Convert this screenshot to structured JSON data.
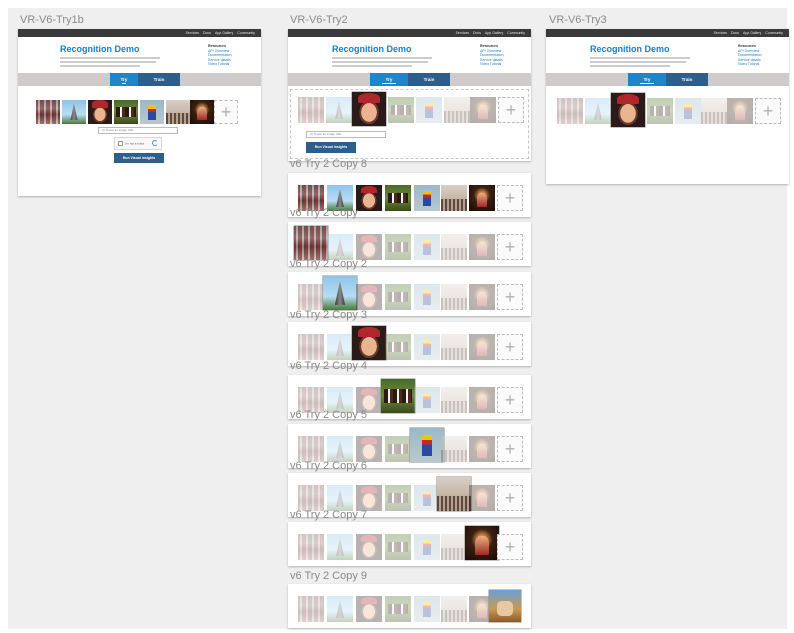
{
  "app": {
    "canvas_bg": "#efefef",
    "accent": "#1e86c8",
    "train_tab_color": "#2e5e8c"
  },
  "frames": {
    "try1b": {
      "label": "VR-V6-Try1b"
    },
    "try2": {
      "label": "VR-V6-Try2"
    },
    "try3": {
      "label": "VR-V6-Try3"
    }
  },
  "site": {
    "title": "Recognition Demo",
    "nav": [
      "Services",
      "Docs",
      "App Gallery",
      "Community"
    ],
    "resources_heading": "Resources",
    "resources": [
      "API Overview",
      "Documentation",
      "Service details",
      "Video Tutorial"
    ],
    "tabs": {
      "try": "Try",
      "train": "Train"
    },
    "url_placeholder": "Or Paste an image URL",
    "captcha_label": "I'm not a robot",
    "run_button": "Run Visual Insights",
    "add_icon": "+"
  },
  "thumbnails": [
    {
      "icon": "crowd-photo"
    },
    {
      "icon": "tower-photo"
    },
    {
      "icon": "face-photo"
    },
    {
      "icon": "horses-photo"
    },
    {
      "icon": "lego-photo"
    },
    {
      "icon": "street-photo"
    },
    {
      "icon": "dance-photo"
    }
  ],
  "variants": [
    {
      "label": "v6 Try 2 Copy 8"
    },
    {
      "label": "v6 Try 2 Copy"
    },
    {
      "label": "v6 Try 2 Copy 2"
    },
    {
      "label": "v6 Try 2 Copy 3"
    },
    {
      "label": "v6 Try 2 Copy 4"
    },
    {
      "label": "v6 Try 2 Copy 5"
    },
    {
      "label": "v6 Try 2 Copy 6"
    },
    {
      "label": "v6 Try 2 Copy 7"
    },
    {
      "label": "v6 Try 2 Copy 9"
    }
  ]
}
